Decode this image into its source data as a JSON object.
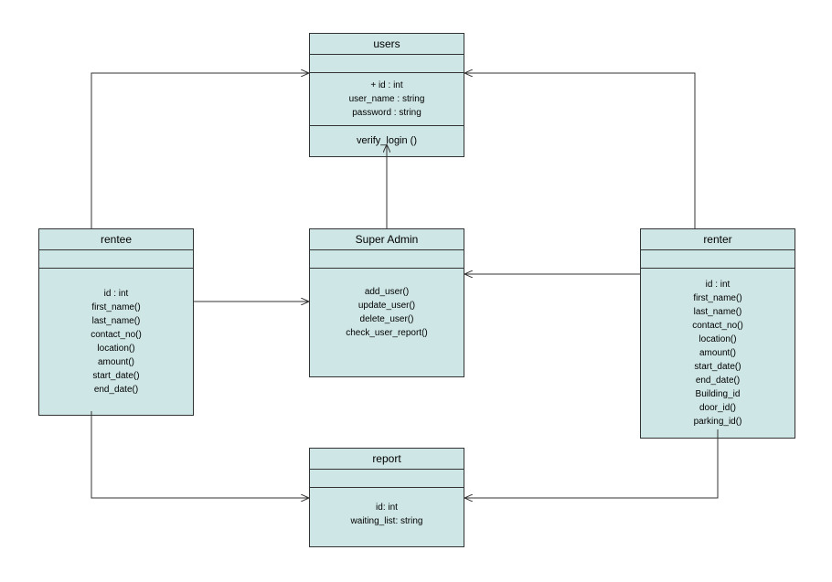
{
  "classes": {
    "users": {
      "title": "users",
      "attributes": [
        "+ id : int",
        "user_name : string",
        "password : string"
      ],
      "methods": [
        "verify_login ()"
      ]
    },
    "rentee": {
      "title": "rentee",
      "attributes": [
        "id : int",
        "first_name()",
        "last_name()",
        "contact_no()",
        "location()",
        "amount()",
        "start_date()",
        "end_date()"
      ]
    },
    "superadmin": {
      "title": "Super Admin",
      "methods": [
        "add_user()",
        "update_user()",
        "delete_user()",
        "check_user_report()"
      ]
    },
    "renter": {
      "title": "renter",
      "attributes": [
        "id : int",
        "first_name()",
        "last_name()",
        "contact_no()",
        "location()",
        "amount()",
        "start_date()",
        "end_date()",
        "Building_id",
        "door_id()",
        "parking_id()"
      ]
    },
    "report": {
      "title": "report",
      "attributes": [
        "id: int",
        "waiting_list: string"
      ]
    }
  },
  "relations": [
    {
      "from": "rentee",
      "to": "users"
    },
    {
      "from": "renter",
      "to": "users"
    },
    {
      "from": "superadmin",
      "to": "users"
    },
    {
      "from": "rentee",
      "to": "superadmin"
    },
    {
      "from": "renter",
      "to": "superadmin"
    },
    {
      "from": "rentee",
      "to": "report"
    },
    {
      "from": "renter",
      "to": "report"
    }
  ]
}
